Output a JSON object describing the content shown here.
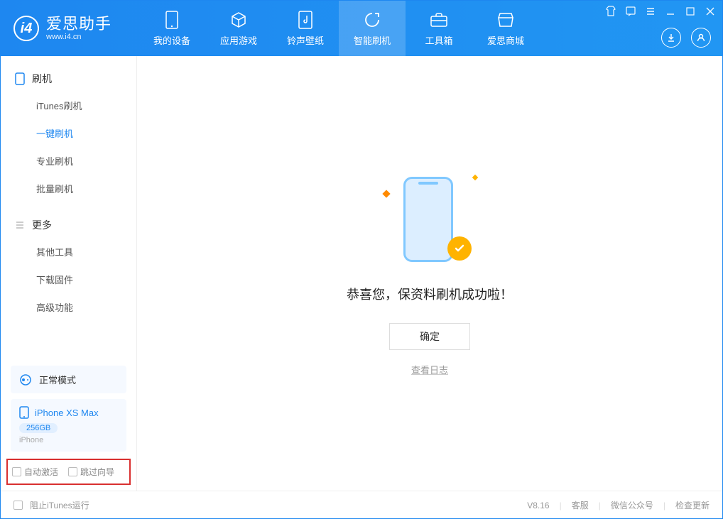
{
  "app": {
    "title": "爱思助手",
    "subtitle": "www.i4.cn"
  },
  "tabs": {
    "device": "我的设备",
    "apps": "应用游戏",
    "ring": "铃声壁纸",
    "flash": "智能刷机",
    "toolbox": "工具箱",
    "store": "爱思商城"
  },
  "sidebar": {
    "section_flash": "刷机",
    "items_flash": {
      "itunes": "iTunes刷机",
      "onekey": "一键刷机",
      "pro": "专业刷机",
      "batch": "批量刷机"
    },
    "section_more": "更多",
    "items_more": {
      "other": "其他工具",
      "firmware": "下载固件",
      "advanced": "高级功能"
    }
  },
  "mode": {
    "label": "正常模式"
  },
  "device": {
    "name": "iPhone XS Max",
    "storage": "256GB",
    "type": "iPhone"
  },
  "checks": {
    "auto_activate": "自动激活",
    "skip_guide": "跳过向导"
  },
  "main": {
    "success": "恭喜您，保资料刷机成功啦！",
    "ok": "确定",
    "log": "查看日志"
  },
  "footer": {
    "block_itunes": "阻止iTunes运行",
    "version": "V8.16",
    "support": "客服",
    "wechat": "微信公众号",
    "update": "检查更新"
  }
}
